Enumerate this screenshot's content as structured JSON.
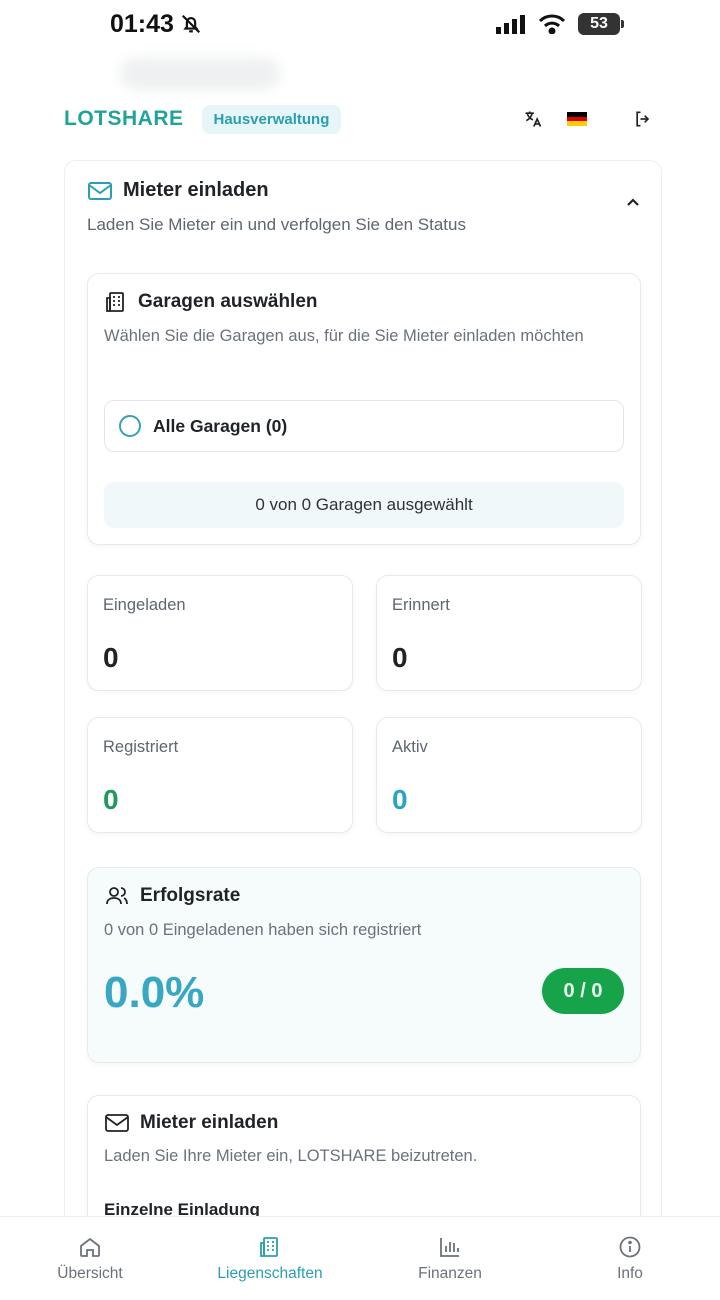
{
  "status_bar": {
    "time": "01:43",
    "battery": "53"
  },
  "header": {
    "brand": "LOTSHARE",
    "role": "Hausverwaltung"
  },
  "invite_section": {
    "title": "Mieter einladen",
    "subtitle": "Laden Sie Mieter ein und verfolgen Sie den Status"
  },
  "garage_select": {
    "title": "Garagen auswählen",
    "description": "Wählen Sie die Garagen aus, für die Sie Mieter einladen möchten",
    "all_label": "Alle Garagen (0)",
    "status": "0 von 0 Garagen ausgewählt"
  },
  "stats": [
    {
      "label": "Eingeladen",
      "value": "0",
      "color": "#1f2328"
    },
    {
      "label": "Erinnert",
      "value": "0",
      "color": "#1f2328"
    },
    {
      "label": "Registriert",
      "value": "0",
      "color": "#1f9a5b"
    },
    {
      "label": "Aktiv",
      "value": "0",
      "color": "#2ba4c2"
    }
  ],
  "success_rate": {
    "title": "Erfolgsrate",
    "description": "0 von 0 Eingeladenen haben sich registriert",
    "value": "0.0%",
    "ratio": "0 / 0"
  },
  "invite_card": {
    "title": "Mieter einladen",
    "description": "Laden Sie Ihre Mieter ein, LOTSHARE beizutreten.",
    "single_invite": "Einzelne Einladung"
  },
  "nav": [
    {
      "label": "Übersicht",
      "icon": "home-icon"
    },
    {
      "label": "Liegenschaften",
      "icon": "building-icon"
    },
    {
      "label": "Finanzen",
      "icon": "bar-chart-icon"
    },
    {
      "label": "Info",
      "icon": "info-icon"
    }
  ],
  "colors": {
    "accent": "#2b9fb0",
    "brand": "#22a39a",
    "success": "#17a34a"
  }
}
